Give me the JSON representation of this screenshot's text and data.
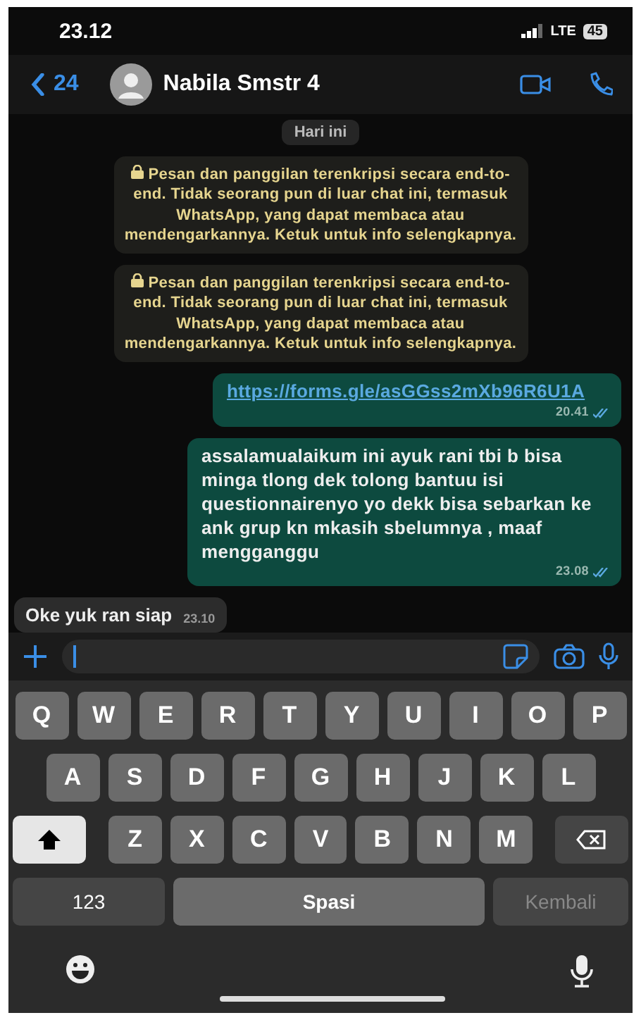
{
  "status_bar": {
    "time": "23.12",
    "network": "LTE",
    "battery": "45"
  },
  "header": {
    "back_count": "24",
    "contact": "Nabila Smstr 4"
  },
  "messages": [
    {
      "kind": "date",
      "text": "Hari ini"
    },
    {
      "kind": "notice",
      "text": "Pesan dan panggilan terenkripsi secara end-to-end. Tidak seorang pun di luar chat ini, termasuk WhatsApp, yang dapat membaca atau mendengarkannya. Ketuk untuk info selengkapnya."
    },
    {
      "kind": "notice",
      "text": "Pesan dan panggilan terenkripsi secara end-to-end. Tidak seorang pun di luar chat ini, termasuk WhatsApp, yang dapat membaca atau mendengarkannya. Ketuk untuk info selengkapnya."
    },
    {
      "kind": "outgoing",
      "link": true,
      "text": "https://forms.gle/asGGss2mXb96R6U1A",
      "time": "20.41",
      "read": true
    },
    {
      "kind": "outgoing",
      "link": false,
      "text": "assalamualaikum ini ayuk rani tbi b bisa minga tlong dek tolong bantuu isi questionnairenyo yo dekk bisa sebarkan ke ank grup kn mkasih sbelumnya , maaf mengganggu",
      "time": "23.08",
      "read": true
    },
    {
      "kind": "incoming",
      "text": "Oke yuk ran siap",
      "time": "23.10"
    }
  ],
  "keyboard": {
    "rows": [
      [
        "Q",
        "W",
        "E",
        "R",
        "T",
        "Y",
        "U",
        "I",
        "O",
        "P"
      ],
      [
        "A",
        "S",
        "D",
        "F",
        "G",
        "H",
        "J",
        "K",
        "L"
      ],
      [
        "Z",
        "X",
        "C",
        "V",
        "B",
        "N",
        "M"
      ]
    ],
    "shift_on": true,
    "number_key": "123",
    "space": "Spasi",
    "return": {
      "label": "Kembali",
      "disabled": true
    }
  }
}
